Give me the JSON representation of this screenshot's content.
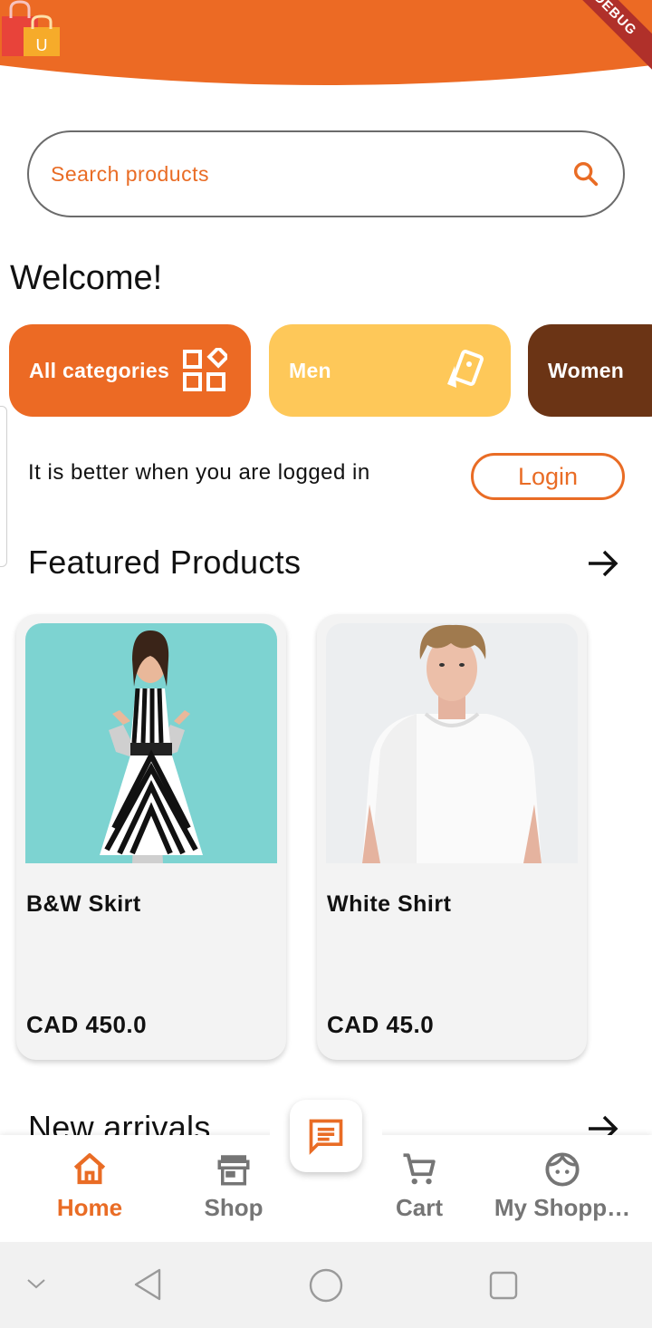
{
  "header": {
    "brand_color": "#ec6a24",
    "logo": "shopping-bag-u-logo",
    "logo_letter": "U",
    "debug_banner": "DEBUG"
  },
  "search": {
    "placeholder": "Search products",
    "icon": "search-icon"
  },
  "welcome": "Welcome!",
  "categories": [
    {
      "label": "All categories",
      "icon": "grid-icon",
      "color": "#ec6a24"
    },
    {
      "label": "Men",
      "icon": "cards-icon",
      "color": "#fec859"
    },
    {
      "label": "Women",
      "icon": "",
      "color": "#6b3415"
    }
  ],
  "login_prompt": {
    "text": "It is better when you are logged in",
    "button": "Login"
  },
  "featured": {
    "title": "Featured Products",
    "products": [
      {
        "name": "B&W Skirt",
        "price": "CAD 450.0",
        "image": "woman-striped-dress-photo"
      },
      {
        "name": "White Shirt",
        "price": "CAD 45.0",
        "image": "man-white-tshirt-photo"
      }
    ]
  },
  "new_arrivals": {
    "title": "New arrivals"
  },
  "bottom_nav": {
    "chat_icon": "chat-icon",
    "items": [
      {
        "label": "Home",
        "icon": "home-icon",
        "active": true
      },
      {
        "label": "Shop",
        "icon": "store-icon",
        "active": false
      },
      {
        "label": "Cart",
        "icon": "cart-icon",
        "active": false
      },
      {
        "label": "My Shopp…",
        "icon": "face-icon",
        "active": false
      }
    ]
  },
  "system_bar": {
    "buttons": [
      "collapse-icon",
      "back-icon",
      "home-circle-icon",
      "recents-icon"
    ]
  }
}
